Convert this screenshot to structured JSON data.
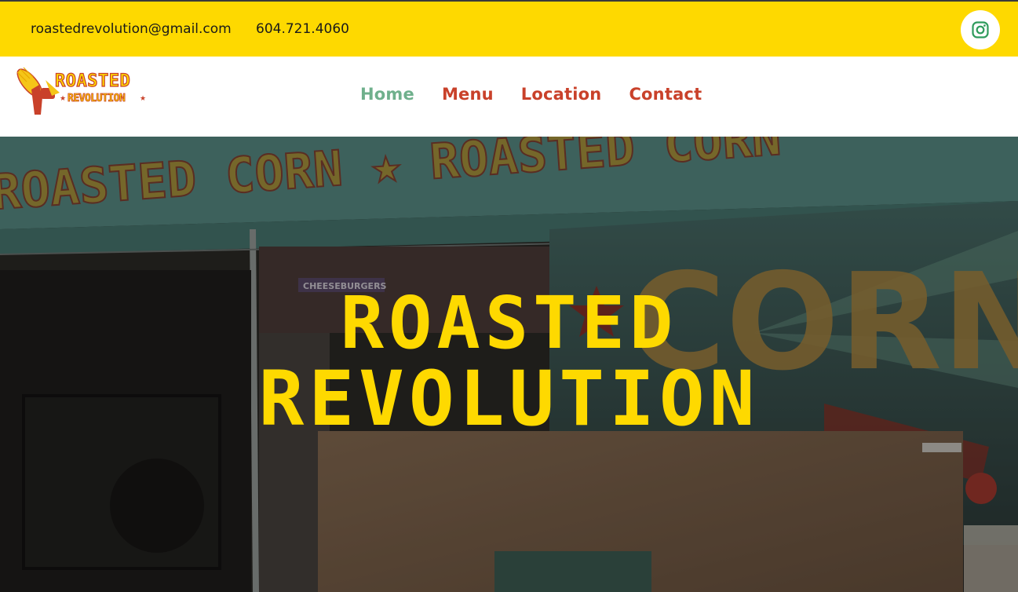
{
  "topbar": {
    "email": "roastedrevolution@gmail.com",
    "phone": "604.721.4060",
    "social_icon": "instagram-icon"
  },
  "logo": {
    "line1": "ROASTED",
    "line2": "REVOLUTION",
    "icon": "corn-fist-icon"
  },
  "nav": {
    "items": [
      {
        "label": "Home",
        "active": true
      },
      {
        "label": "Menu",
        "active": false
      },
      {
        "label": "Location",
        "active": false
      },
      {
        "label": "Contact",
        "active": false
      }
    ]
  },
  "hero": {
    "title_line1": "ROASTED",
    "title_line2": "REVOLUTION",
    "bg_canopy_text": "ROASTED CORN ★ ROASTED CORN",
    "bg_sign_text": "CORN",
    "bg_booth_sign": "CHEESEBURGERS"
  },
  "colors": {
    "brand_yellow": "#fed900",
    "brand_red": "#c9412a",
    "nav_active": "#6fb08c",
    "instagram_green": "#2e9b5c"
  }
}
